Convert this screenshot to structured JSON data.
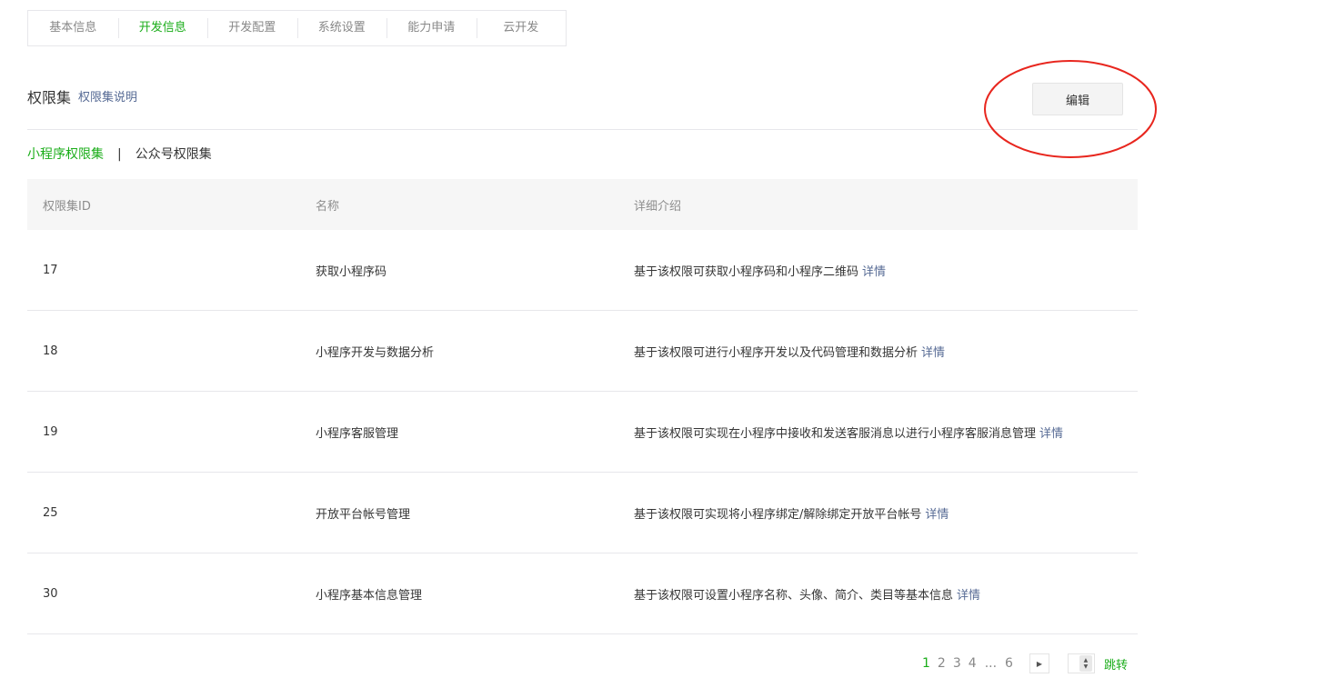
{
  "tabs": [
    {
      "label": "基本信息"
    },
    {
      "label": "开发信息"
    },
    {
      "label": "开发配置"
    },
    {
      "label": "系统设置"
    },
    {
      "label": "能力申请"
    },
    {
      "label": "云开发"
    }
  ],
  "active_tab": "开发信息",
  "section": {
    "title": "权限集",
    "link": "权限集说明",
    "edit_label": "编辑"
  },
  "subtabs": {
    "miniprogram": "小程序权限集",
    "separator": "|",
    "official": "公众号权限集"
  },
  "table": {
    "headers": {
      "id": "权限集ID",
      "name": "名称",
      "desc": "详细介绍"
    },
    "detail_label": "详情",
    "rows": [
      {
        "id": "17",
        "name": "获取小程序码",
        "desc": "基于该权限可获取小程序码和小程序二维码"
      },
      {
        "id": "18",
        "name": "小程序开发与数据分析",
        "desc": "基于该权限可进行小程序开发以及代码管理和数据分析"
      },
      {
        "id": "19",
        "name": "小程序客服管理",
        "desc": "基于该权限可实现在小程序中接收和发送客服消息以进行小程序客服消息管理"
      },
      {
        "id": "25",
        "name": "开放平台帐号管理",
        "desc": "基于该权限可实现将小程序绑定/解除绑定开放平台帐号"
      },
      {
        "id": "30",
        "name": "小程序基本信息管理",
        "desc": "基于该权限可设置小程序名称、头像、简介、类目等基本信息"
      }
    ]
  },
  "pagination": {
    "pages": [
      "1",
      "2",
      "3",
      "4"
    ],
    "ellipsis": "...",
    "last": "6",
    "current": "1",
    "jump_label": "跳转"
  },
  "colors": {
    "accent_green": "#1aad19",
    "link_blue": "#576b95",
    "annotation_red": "#e8261e"
  }
}
